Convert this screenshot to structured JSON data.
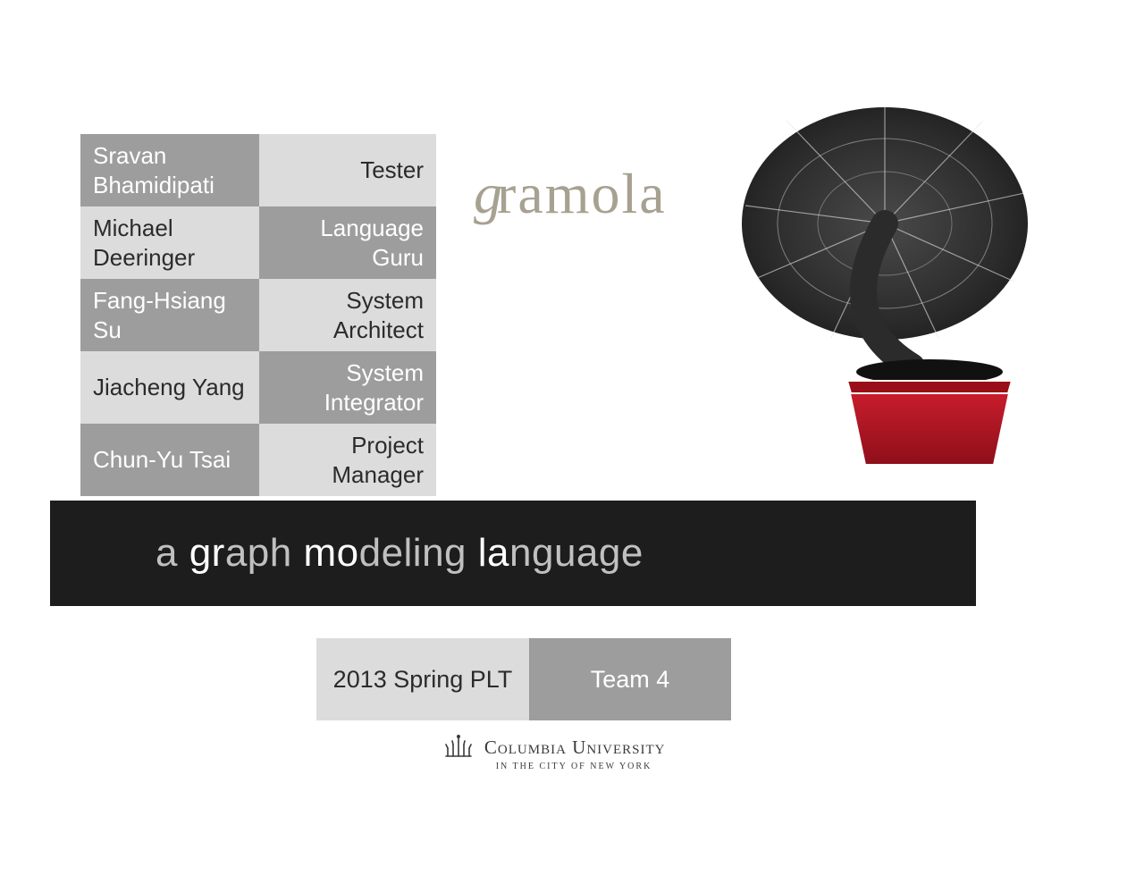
{
  "team": [
    {
      "name": "Sravan Bhamidipati",
      "role": "Tester"
    },
    {
      "name": "Michael Deeringer",
      "role": "Language Guru"
    },
    {
      "name": "Fang-Hsiang Su",
      "role": "System Architect"
    },
    {
      "name": "Jiacheng Yang",
      "role": "System Integrator"
    },
    {
      "name": "Chun-Yu Tsai",
      "role": "Project Manager"
    }
  ],
  "logo_text": "gramola",
  "tagline": {
    "prefix": "a ",
    "w1a": "gr",
    "w1b": "aph ",
    "w2a": "mo",
    "w2b": "deling ",
    "w3a": "la",
    "w3b": "nguage"
  },
  "course": {
    "left": "2013 Spring PLT",
    "right": "Team 4"
  },
  "university": {
    "main": "Columbia University",
    "sub": "in the city of New York"
  }
}
